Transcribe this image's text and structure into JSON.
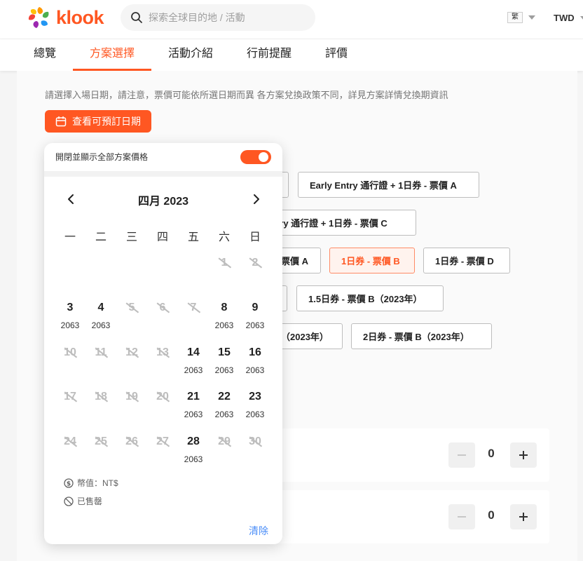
{
  "header": {
    "brand": "klook",
    "search_placeholder": "探索全球目的地 / 活動",
    "language": "繁",
    "currency": "TWD"
  },
  "tabs": [
    "總覽",
    "方案選擇",
    "活動介紹",
    "行前提醒",
    "評價"
  ],
  "active_tab": "方案選擇",
  "main": {
    "notice": "請選擇入場日期，請注意，票價可能依所選日期而異 各方案兌換政策不同，詳見方案詳情兌換期資訊",
    "date_button": "查看可預訂日期",
    "chips": [
      "Early Entry 通行證 + 1日券 - 票價 A",
      "ntry 通行證 + 1日券 - 票價 C",
      "票價 A",
      "1日券 - 票價 B",
      "1日券 - 票價 D",
      "1.5日券 - 票價 B（2023年）",
      "（2023年）",
      "2日券 - 票價 B（2023年）"
    ],
    "selected_chip": "1日券 - 票價 B",
    "quantities": [
      "0",
      "0"
    ]
  },
  "calendar": {
    "toggle_label": "開閉並顯示全部方案價格",
    "toggle_on": true,
    "month": "四月 2023",
    "weekdays": [
      "一",
      "二",
      "三",
      "四",
      "五",
      "六",
      "日"
    ],
    "days": [
      {
        "day": "1",
        "price": "",
        "available": false
      },
      {
        "day": "2",
        "price": "",
        "available": false
      },
      {
        "day": "3",
        "price": "2063",
        "available": true
      },
      {
        "day": "4",
        "price": "2063",
        "available": true
      },
      {
        "day": "5",
        "price": "",
        "available": false
      },
      {
        "day": "6",
        "price": "",
        "available": false
      },
      {
        "day": "7",
        "price": "",
        "available": false
      },
      {
        "day": "8",
        "price": "2063",
        "available": true
      },
      {
        "day": "9",
        "price": "2063",
        "available": true
      },
      {
        "day": "10",
        "price": "",
        "available": false
      },
      {
        "day": "11",
        "price": "",
        "available": false
      },
      {
        "day": "12",
        "price": "",
        "available": false
      },
      {
        "day": "13",
        "price": "",
        "available": false
      },
      {
        "day": "14",
        "price": "2063",
        "available": true
      },
      {
        "day": "15",
        "price": "2063",
        "available": true
      },
      {
        "day": "16",
        "price": "2063",
        "available": true
      },
      {
        "day": "17",
        "price": "",
        "available": false
      },
      {
        "day": "18",
        "price": "",
        "available": false
      },
      {
        "day": "19",
        "price": "",
        "available": false
      },
      {
        "day": "20",
        "price": "",
        "available": false
      },
      {
        "day": "21",
        "price": "2063",
        "available": true
      },
      {
        "day": "22",
        "price": "2063",
        "available": true
      },
      {
        "day": "23",
        "price": "2063",
        "available": true
      },
      {
        "day": "24",
        "price": "",
        "available": false
      },
      {
        "day": "25",
        "price": "",
        "available": false
      },
      {
        "day": "26",
        "price": "",
        "available": false
      },
      {
        "day": "27",
        "price": "",
        "available": false
      },
      {
        "day": "28",
        "price": "2063",
        "available": true
      },
      {
        "day": "29",
        "price": "",
        "available": false
      },
      {
        "day": "30",
        "price": "",
        "available": false
      }
    ],
    "legend_currency": "幣值：NT$",
    "legend_soldout": "已售罄",
    "clear_label": "清除"
  },
  "colors": {
    "accent": "#ff5722",
    "link": "#4a8df8",
    "disabled": "#bdbdbd"
  }
}
